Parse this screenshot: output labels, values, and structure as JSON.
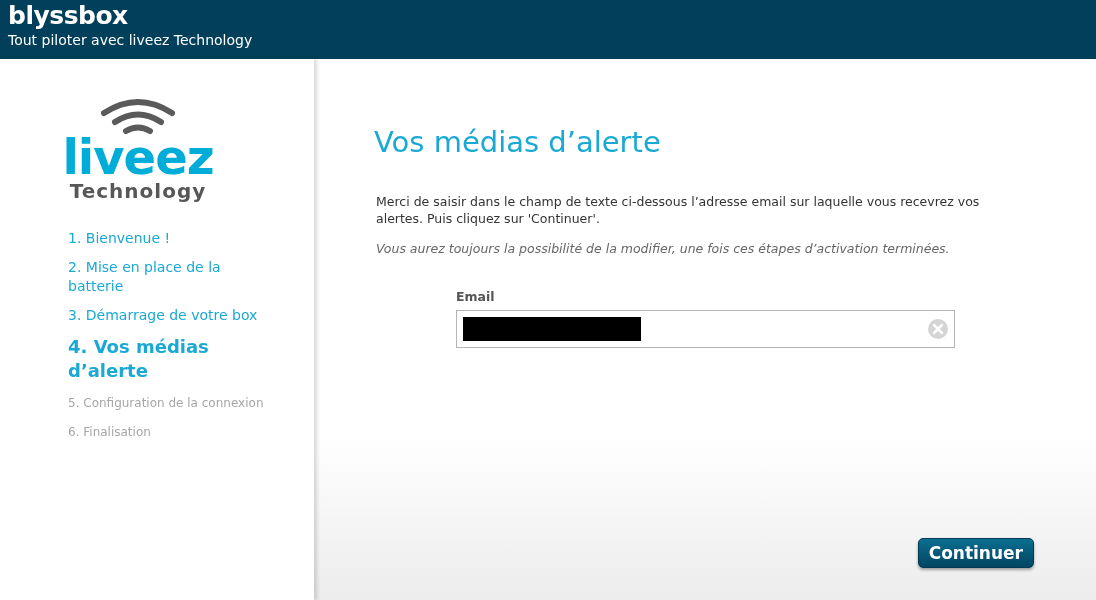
{
  "header": {
    "brand": "blyssbox",
    "tagline": "Tout piloter avec liveez Technology"
  },
  "logo": {
    "name": "liveez",
    "subtitle": "Technology"
  },
  "steps": [
    {
      "label": "1. Bienvenue !",
      "done": true,
      "selected": false
    },
    {
      "label": "2. Mise en place de la batterie",
      "done": true,
      "selected": false
    },
    {
      "label": "3. Démarrage de votre box",
      "done": true,
      "selected": false
    },
    {
      "label": "4. Vos médias d’alerte",
      "done": true,
      "selected": true
    },
    {
      "label": "5. Configuration de la connexion",
      "done": false,
      "selected": false
    },
    {
      "label": "6. Finalisation",
      "done": false,
      "selected": false
    }
  ],
  "main": {
    "title": "Vos médias d’alerte",
    "intro": "Merci de saisir dans le champ de texte ci-dessous l’adresse email sur laquelle vous recevrez vos alertes. Puis cliquez sur 'Continuer'.",
    "note": "Vous aurez toujours la possibilité de la modifier, une fois ces étapes d’activation terminées.",
    "email_label": "Email",
    "email_redacted": true
  },
  "continue_button": "Continuer"
}
